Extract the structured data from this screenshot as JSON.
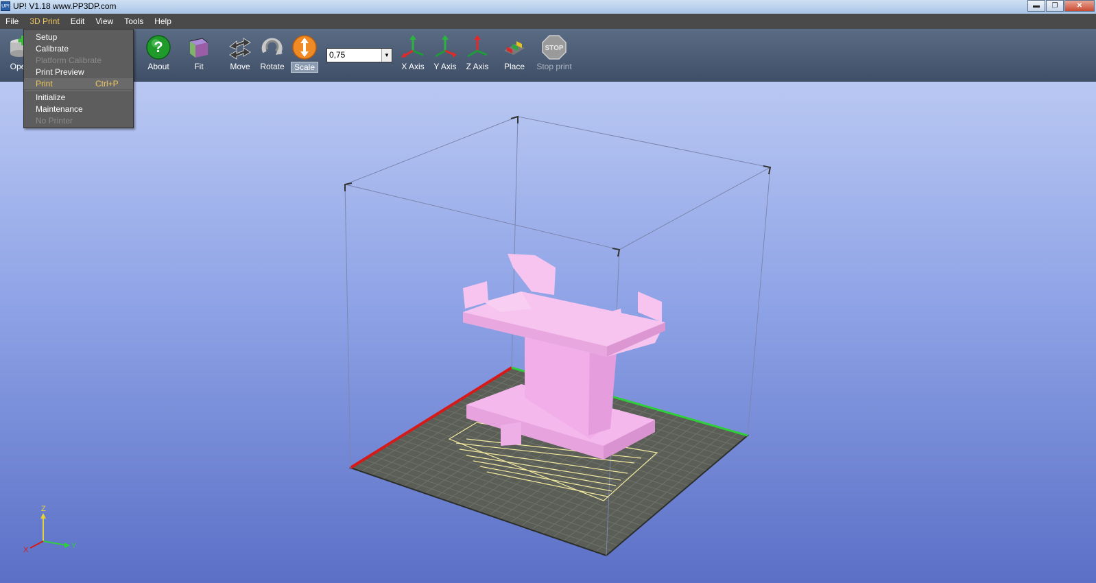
{
  "window": {
    "title": "UP!  V1.18  www.PP3DP.com",
    "app_icon_text": "UP!",
    "controls": {
      "minimize": "▬",
      "restore": "❐",
      "close": "✕"
    }
  },
  "menubar": {
    "items": [
      "File",
      "3D Print",
      "Edit",
      "View",
      "Tools",
      "Help"
    ],
    "active": "3D Print"
  },
  "toolbar": {
    "open_label": "Oper",
    "about_label": "About",
    "fit_label": "Fit",
    "move_label": "Move",
    "rotate_label": "Rotate",
    "scale_label": "Scale",
    "scale_value": "0,75",
    "x_axis_label": "X Axis",
    "y_axis_label": "Y Axis",
    "z_axis_label": "Z Axis",
    "place_label": "Place",
    "stop_label": "Stop print",
    "stop_icon_text": "STOP"
  },
  "dropdown_3dprint": {
    "items": [
      {
        "label": "Setup",
        "shortcut": "",
        "disabled": false
      },
      {
        "label": "Calibrate",
        "shortcut": "",
        "disabled": false
      },
      {
        "label": "Platform Calibrate",
        "shortcut": "",
        "disabled": true
      },
      {
        "label": "Print Preview",
        "shortcut": "",
        "disabled": false
      },
      {
        "label": "Print",
        "shortcut": "Ctrl+P",
        "disabled": false
      },
      {
        "label": "Initialize",
        "shortcut": "",
        "disabled": false
      },
      {
        "label": "Maintenance",
        "shortcut": "",
        "disabled": false
      },
      {
        "label": "No Printer",
        "shortcut": "",
        "disabled": true
      }
    ]
  },
  "viewport": {
    "axis_labels": {
      "x": "X",
      "y": "Y",
      "z": "Z"
    },
    "colors": {
      "model": "#f4b8ec",
      "platform": "#5a5e56",
      "grid_line": "#6e7268",
      "x_axis_edge": "#d61a1a",
      "y_axis_edge": "#2fcf3b",
      "raft": "#f3e9a0"
    }
  }
}
